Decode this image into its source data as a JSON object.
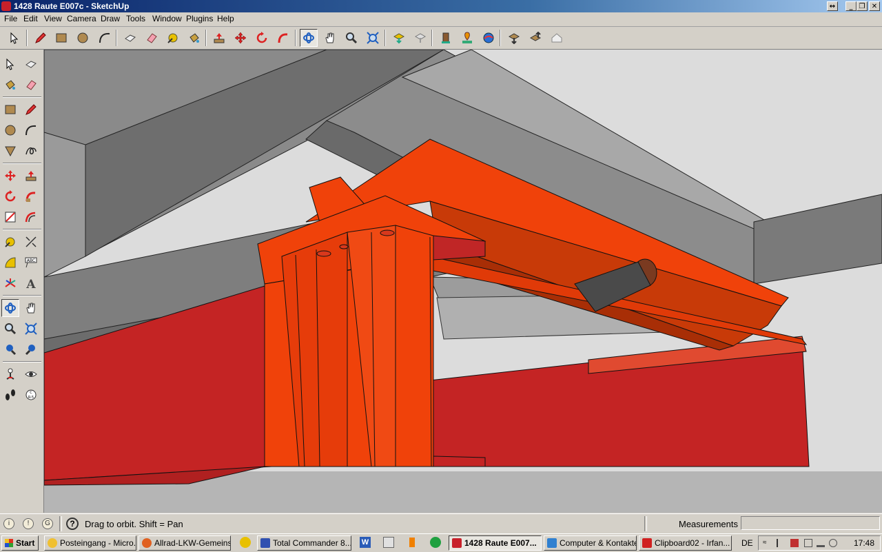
{
  "window": {
    "title": "1428 Raute E007c - SketchUp"
  },
  "menu": [
    "File",
    "Edit",
    "View",
    "Camera",
    "Draw",
    "Tools",
    "Window",
    "Plugins",
    "Help"
  ],
  "status": {
    "hint": "Drag to orbit.  Shift = Pan",
    "measurements_label": "Measurements",
    "measurements_value": ""
  },
  "taskbar": {
    "start": "Start",
    "tasks": [
      "Posteingang - Micro...",
      "Allrad-LKW-Gemeins...",
      "Total Commander 8....",
      "1428 Raute E007...",
      "Computer & Kontakte",
      "Clipboard02 - Irfan..."
    ],
    "language": "DE",
    "clock": "17:48"
  },
  "colors": {
    "steel_orange": "#f0420a",
    "steel_red": "#c42424",
    "beam_gray": "#7a7a7a",
    "sky": "#dcdcdc",
    "ground": "#b4b4b4"
  }
}
